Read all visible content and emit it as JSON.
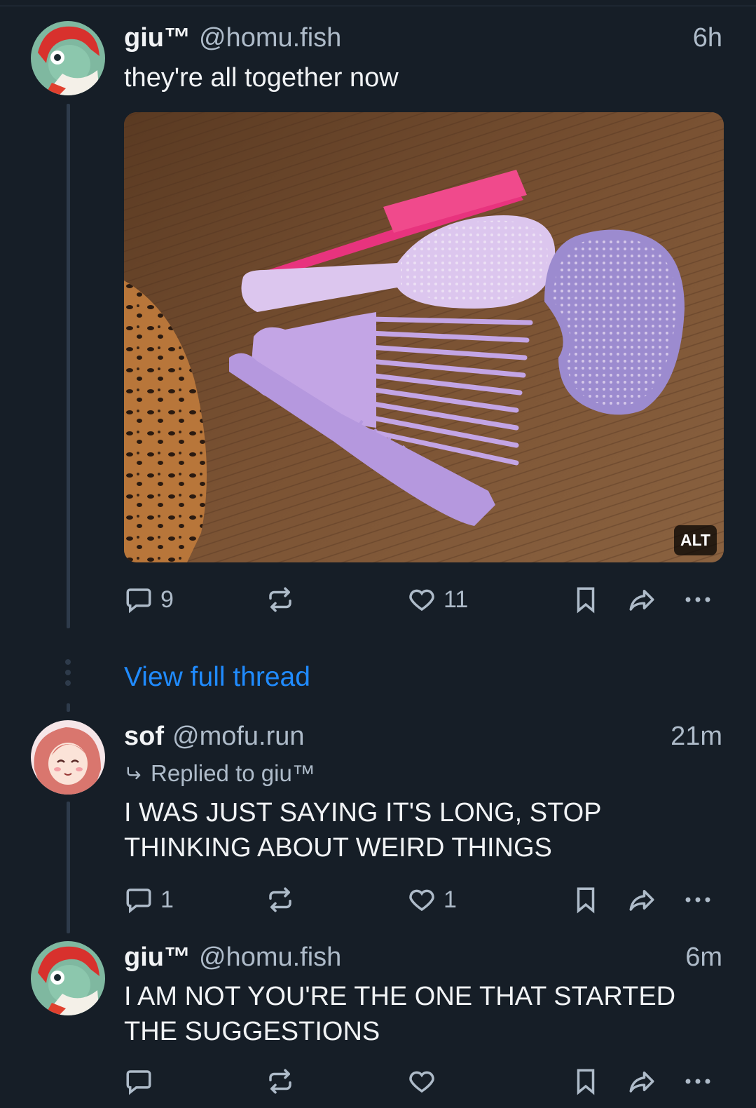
{
  "posts": [
    {
      "author": "giu™",
      "handle": "@homu.fish",
      "time": "6h",
      "text": "they're all together now",
      "image_alt_badge": "ALT",
      "reply_count": "9",
      "repost_count": "",
      "like_count": "11"
    },
    {
      "author": "sof",
      "handle": "@mofu.run",
      "time": "21m",
      "replied_to": "Replied to giu™",
      "text": "I WAS JUST SAYING IT'S LONG, STOP THINKING ABOUT WEIRD THINGS",
      "reply_count": "1",
      "repost_count": "",
      "like_count": "1"
    },
    {
      "author": "giu™",
      "handle": "@homu.fish",
      "time": "6m",
      "text": "I AM NOT YOU'RE THE ONE THAT STARTED THE SUGGESTIONS",
      "reply_count": "",
      "repost_count": "",
      "like_count": ""
    }
  ],
  "thread_link": "View full thread",
  "colors": {
    "background": "#161e27",
    "text": "#f1f3f5",
    "muted": "#aebbc9",
    "link": "#208bfe",
    "thread_line": "#2e3b4b"
  },
  "icons": [
    "reply-icon",
    "repost-icon",
    "like-icon",
    "bookmark-icon",
    "share-icon",
    "more-icon",
    "reply-arrow-icon"
  ]
}
